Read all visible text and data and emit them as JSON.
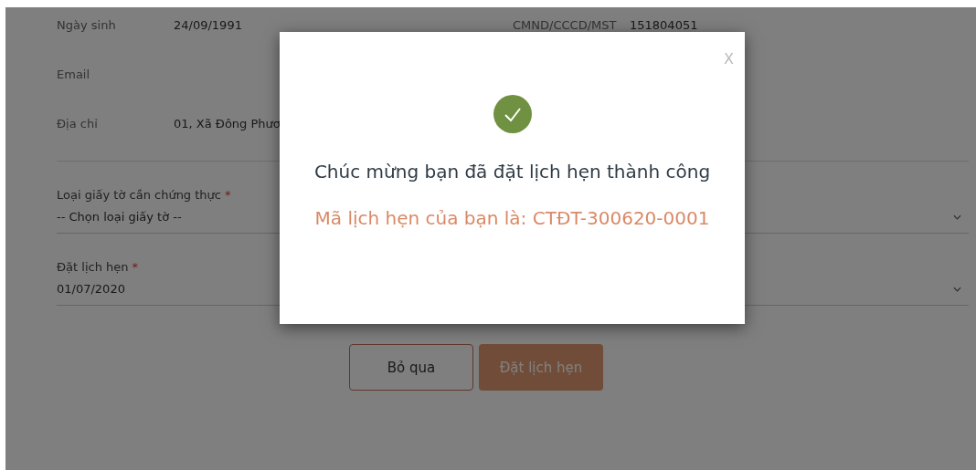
{
  "info_rows": [
    {
      "cells": [
        {
          "label": "Ngày sinh",
          "value": "24/09/1991"
        },
        {
          "label": "CMND/CCCD/MST",
          "value": "151804051"
        }
      ]
    },
    {
      "cells": [
        {
          "label": "Email"
        }
      ]
    },
    {
      "cells": [
        {
          "label": "Địa chỉ",
          "value": "01, Xã Đông Phươ"
        }
      ]
    }
  ],
  "fields": [
    {
      "label": "Loại giấy tờ cần chứng thực",
      "required_mark": "*",
      "value": "-- Chọn loại giấy tờ --",
      "kind": "select"
    },
    {
      "label": "Đặt lịch hẹn",
      "required_mark": "*",
      "value": "01/07/2020",
      "kind": "select"
    }
  ],
  "buttons": [
    {
      "label": "Bỏ qua",
      "kind": "outline"
    },
    {
      "label": "Đặt lịch hẹn",
      "kind": "primary"
    }
  ],
  "dialog": {
    "close": "X",
    "title": "Chúc mừng bạn đã đặt lịch hẹn thành công",
    "message": "Mã lịch hẹn của bạn là: CTĐT-300620-0001"
  }
}
